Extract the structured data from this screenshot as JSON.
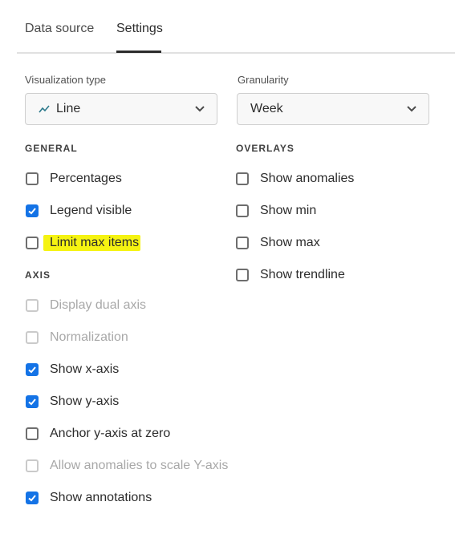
{
  "tabs": [
    {
      "label": "Data source"
    },
    {
      "label": "Settings"
    }
  ],
  "visualization_type": {
    "label": "Visualization type",
    "value": "Line",
    "icon": "line-chart-icon"
  },
  "granularity": {
    "label": "Granularity",
    "value": "Week"
  },
  "general": {
    "heading": "GENERAL",
    "items": [
      {
        "label": "Percentages",
        "checked": false,
        "disabled": false
      },
      {
        "label": "Legend visible",
        "checked": true,
        "disabled": false
      },
      {
        "label": "Limit max items",
        "checked": false,
        "disabled": false,
        "highlighted": true
      }
    ]
  },
  "overlays": {
    "heading": "OVERLAYS",
    "items": [
      {
        "label": "Show anomalies",
        "checked": false,
        "disabled": false
      },
      {
        "label": "Show min",
        "checked": false,
        "disabled": false
      },
      {
        "label": "Show max",
        "checked": false,
        "disabled": false
      },
      {
        "label": "Show trendline",
        "checked": false,
        "disabled": false
      }
    ]
  },
  "axis": {
    "heading": "AXIS",
    "items": [
      {
        "label": "Display dual axis",
        "checked": false,
        "disabled": true
      },
      {
        "label": "Normalization",
        "checked": false,
        "disabled": true
      },
      {
        "label": "Show x-axis",
        "checked": true,
        "disabled": false
      },
      {
        "label": "Show y-axis",
        "checked": true,
        "disabled": false
      },
      {
        "label": "Anchor y-axis at zero",
        "checked": false,
        "disabled": false
      },
      {
        "label": "Allow anomalies to scale Y-axis",
        "checked": false,
        "disabled": true
      },
      {
        "label": "Show annotations",
        "checked": true,
        "disabled": false
      }
    ]
  },
  "colors": {
    "accent": "#1473e6",
    "highlight": "#f5f312",
    "disabled_text": "#a8a8a8"
  }
}
